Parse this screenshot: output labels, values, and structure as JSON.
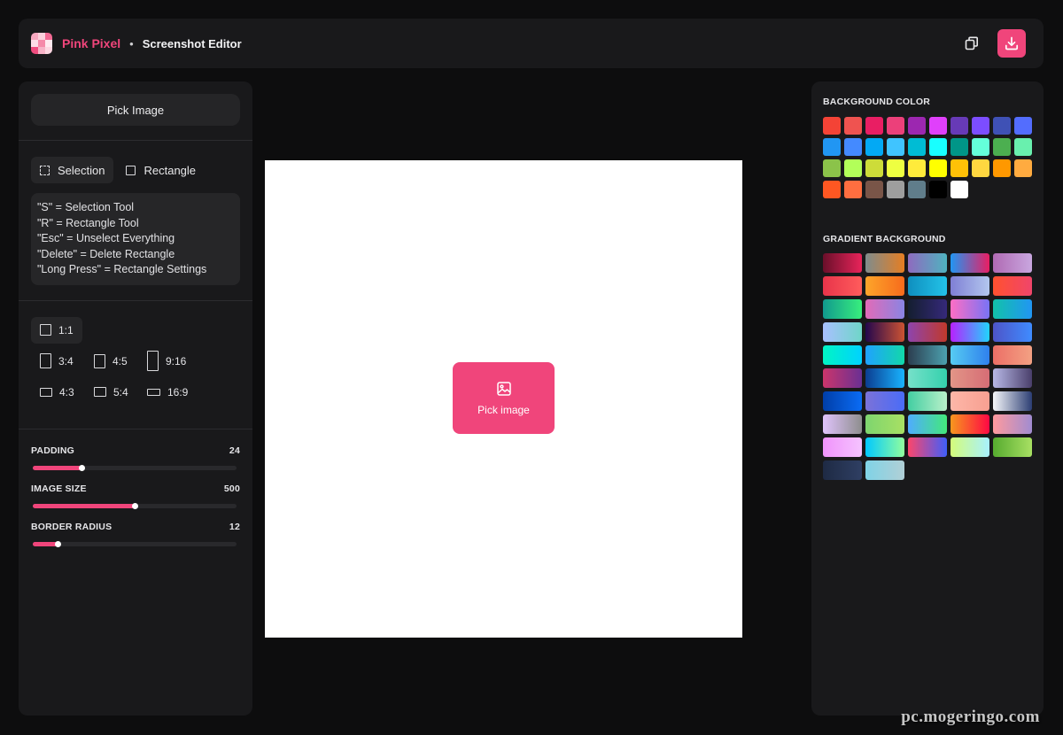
{
  "header": {
    "brand": "Pink Pixel",
    "separator": "•",
    "title": "Screenshot Editor",
    "copy_icon": "copy-icon",
    "download_icon": "download-icon"
  },
  "colors": {
    "accent": "#f0457b",
    "panel": "#19191b",
    "background": "#0d0d0e"
  },
  "left_panel": {
    "pick_image_label": "Pick Image",
    "tools": [
      {
        "label": "Selection",
        "icon": "selection-icon",
        "active": true
      },
      {
        "label": "Rectangle",
        "icon": "rectangle-icon",
        "active": false
      }
    ],
    "shortcuts": [
      "\"S\" = Selection Tool",
      "\"R\" = Rectangle Tool",
      "\"Esc\" = Unselect Everything",
      "\"Delete\" = Delete Rectangle",
      "\"Long Press\" = Rectangle Settings"
    ],
    "aspect_ratios": [
      {
        "label": "1:1",
        "active": true
      },
      {
        "label": "3:4",
        "active": false
      },
      {
        "label": "4:5",
        "active": false
      },
      {
        "label": "9:16",
        "active": false
      },
      {
        "label": "4:3",
        "active": false
      },
      {
        "label": "5:4",
        "active": false
      },
      {
        "label": "16:9",
        "active": false
      }
    ],
    "sliders": [
      {
        "label": "PADDING",
        "value": "24",
        "fraction": 0.24
      },
      {
        "label": "IMAGE SIZE",
        "value": "500",
        "fraction": 0.5
      },
      {
        "label": "BORDER RADIUS",
        "value": "12",
        "fraction": 0.12
      }
    ]
  },
  "canvas": {
    "pick_label": "Pick image",
    "icon": "image-icon"
  },
  "right_panel": {
    "background_color_title": "BACKGROUND COLOR",
    "solid_colors": [
      "#f44336",
      "#ef5350",
      "#e91e63",
      "#ec407a",
      "#9c27b0",
      "#e040fb",
      "#673ab7",
      "#7c4dff",
      "#3f51b5",
      "#536dfe",
      "#2196f3",
      "#448aff",
      "#03a9f4",
      "#40c4ff",
      "#00bcd4",
      "#18ffff",
      "#009688",
      "#64ffda",
      "#4caf50",
      "#69f0ae",
      "#8bc34a",
      "#b2ff59",
      "#cddc39",
      "#eeff41",
      "#ffeb3b",
      "#ffff00",
      "#ffc107",
      "#ffd740",
      "#ff9800",
      "#ffab40",
      "#ff5722",
      "#ff6e40",
      "#795548",
      "#9e9e9e",
      "#607d8b",
      "#000000",
      "#ffffff"
    ],
    "gradient_title": "GRADIENT BACKGROUND",
    "gradients": [
      [
        "#6a0f2a",
        "#e8245a"
      ],
      [
        "#7f8c8d",
        "#e67e22"
      ],
      [
        "#8e6bbf",
        "#4fb3bf"
      ],
      [
        "#2196f3",
        "#e91e63"
      ],
      [
        "#b06ab3",
        "#c9a7e0"
      ],
      [
        "#e8344a",
        "#ff5c5c"
      ],
      [
        "#fda52a",
        "#f76b1c"
      ],
      [
        "#0f8fbf",
        "#23c3e8"
      ],
      [
        "#7f7fd5",
        "#b3c7ee"
      ],
      [
        "#ff512f",
        "#f0456b"
      ],
      [
        "#11998e",
        "#38ef7d"
      ],
      [
        "#e26bb8",
        "#8a84e2"
      ],
      [
        "#141e30",
        "#35297a"
      ],
      [
        "#ff6ec4",
        "#7873f5"
      ],
      [
        "#12c2a9",
        "#2196f3"
      ],
      [
        "#a8c0ff",
        "#6fd6c8"
      ],
      [
        "#23074d",
        "#cc5333"
      ],
      [
        "#8e44ad",
        "#c0392b"
      ],
      [
        "#b721ff",
        "#21d4fd"
      ],
      [
        "#4e54c8",
        "#3f8cff"
      ],
      [
        "#00f5c4",
        "#00d2ff"
      ],
      [
        "#1fa2ff",
        "#12d8a9"
      ],
      [
        "#2c3e50",
        "#4ca1af"
      ],
      [
        "#56ccf2",
        "#2f80ed"
      ],
      [
        "#ec6f66",
        "#f3a183"
      ],
      [
        "#cb356b",
        "#6a3093"
      ],
      [
        "#0b3d91",
        "#19b4ff"
      ],
      [
        "#76e0c9",
        "#34d1ad"
      ],
      [
        "#e29587",
        "#d66d75"
      ],
      [
        "#b7b8e6",
        "#4a3f6b"
      ],
      [
        "#003ea8",
        "#0a6cf5"
      ],
      [
        "#7b72d8",
        "#4a6cf7"
      ],
      [
        "#43cea2",
        "#b9f0c9"
      ],
      [
        "#fdb7a8",
        "#f79f91"
      ],
      [
        "#f5f7fa",
        "#2c3e73"
      ],
      [
        "#e0c3fc",
        "#8e8e8e"
      ],
      [
        "#7ed56f",
        "#a8e063"
      ],
      [
        "#4facfe",
        "#43e97b"
      ],
      [
        "#f7971e",
        "#ff0844"
      ],
      [
        "#ff9a9e",
        "#a18cd1"
      ],
      [
        "#f093fb",
        "#f5c3ff"
      ],
      [
        "#00c9ff",
        "#92fe9d"
      ],
      [
        "#fc466b",
        "#3f5efb"
      ],
      [
        "#d4fc79",
        "#a8f0ff"
      ],
      [
        "#56ab2f",
        "#a8e063"
      ],
      [
        "#1e2a44",
        "#2f3f63"
      ],
      [
        "#7fd3e6",
        "#b1cfd6"
      ]
    ]
  }
}
